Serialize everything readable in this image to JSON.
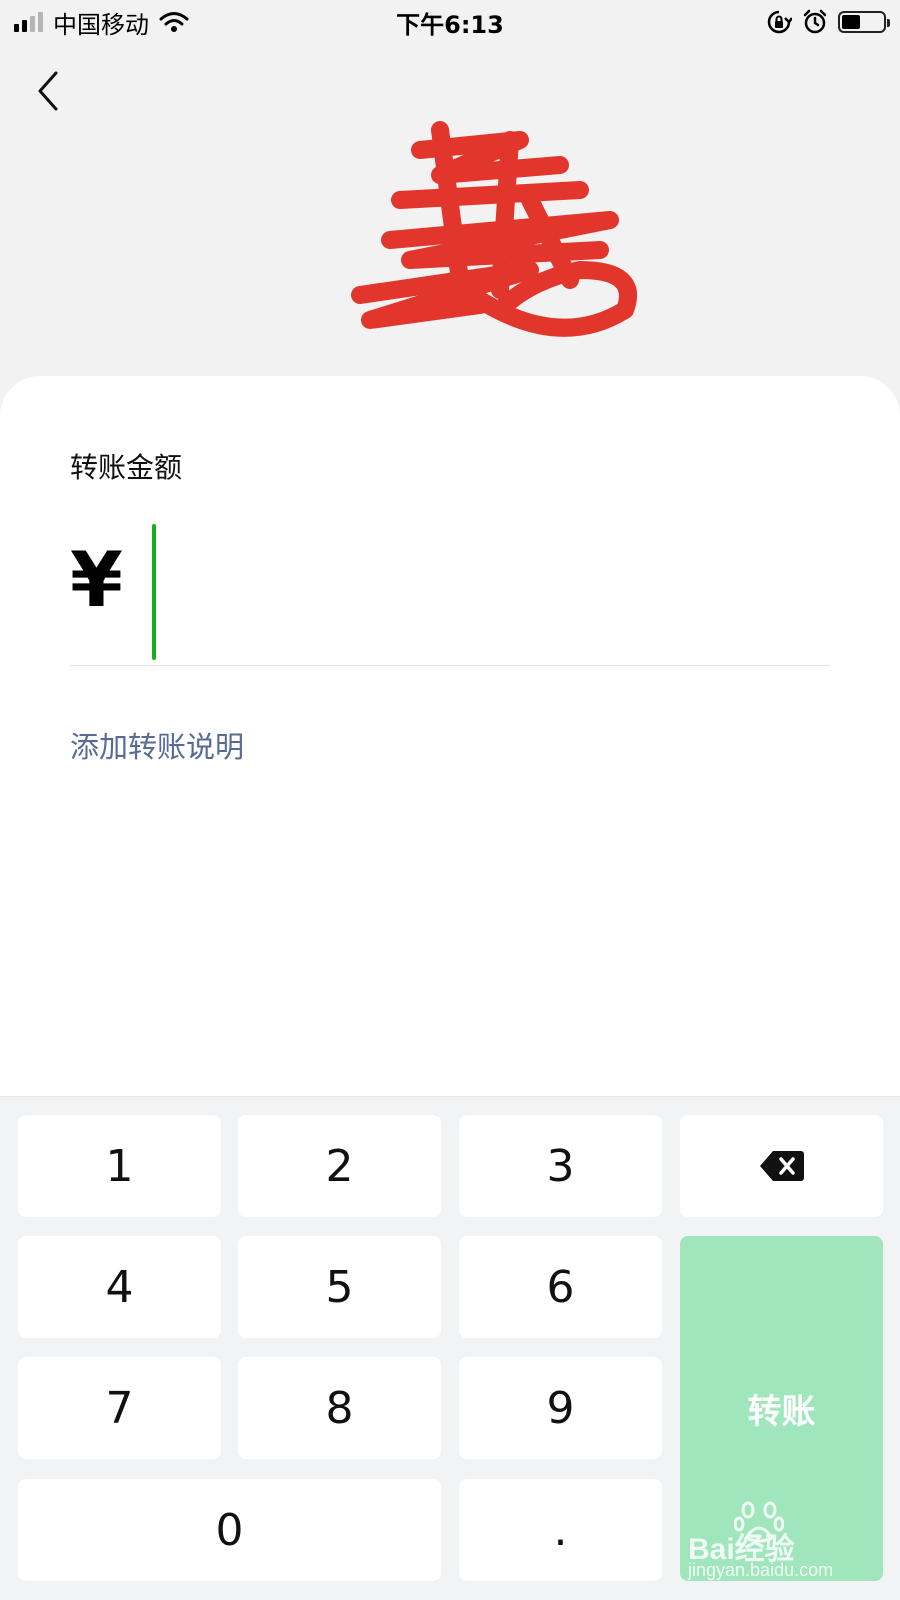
{
  "status_bar": {
    "carrier": "中国移动",
    "time": "下午6:13",
    "battery_level": 0.45
  },
  "nav": {
    "back_icon": "chevron-left-icon"
  },
  "form": {
    "amount_label": "转账金额",
    "currency_symbol": "¥",
    "amount_value": "",
    "add_note_link": "添加转账说明"
  },
  "keypad": {
    "keys": [
      "1",
      "2",
      "3",
      "4",
      "5",
      "6",
      "7",
      "8",
      "9",
      "0",
      "."
    ],
    "delete_icon": "backspace-icon",
    "transfer_label": "转账"
  },
  "watermark": {
    "brand": "Bai经验",
    "url": "jingyan.baidu.com"
  },
  "colors": {
    "accent_green": "#1aad19",
    "transfer_button": "#9fe6bc",
    "link_blue": "#576b95",
    "redaction_red": "#e2362c"
  }
}
